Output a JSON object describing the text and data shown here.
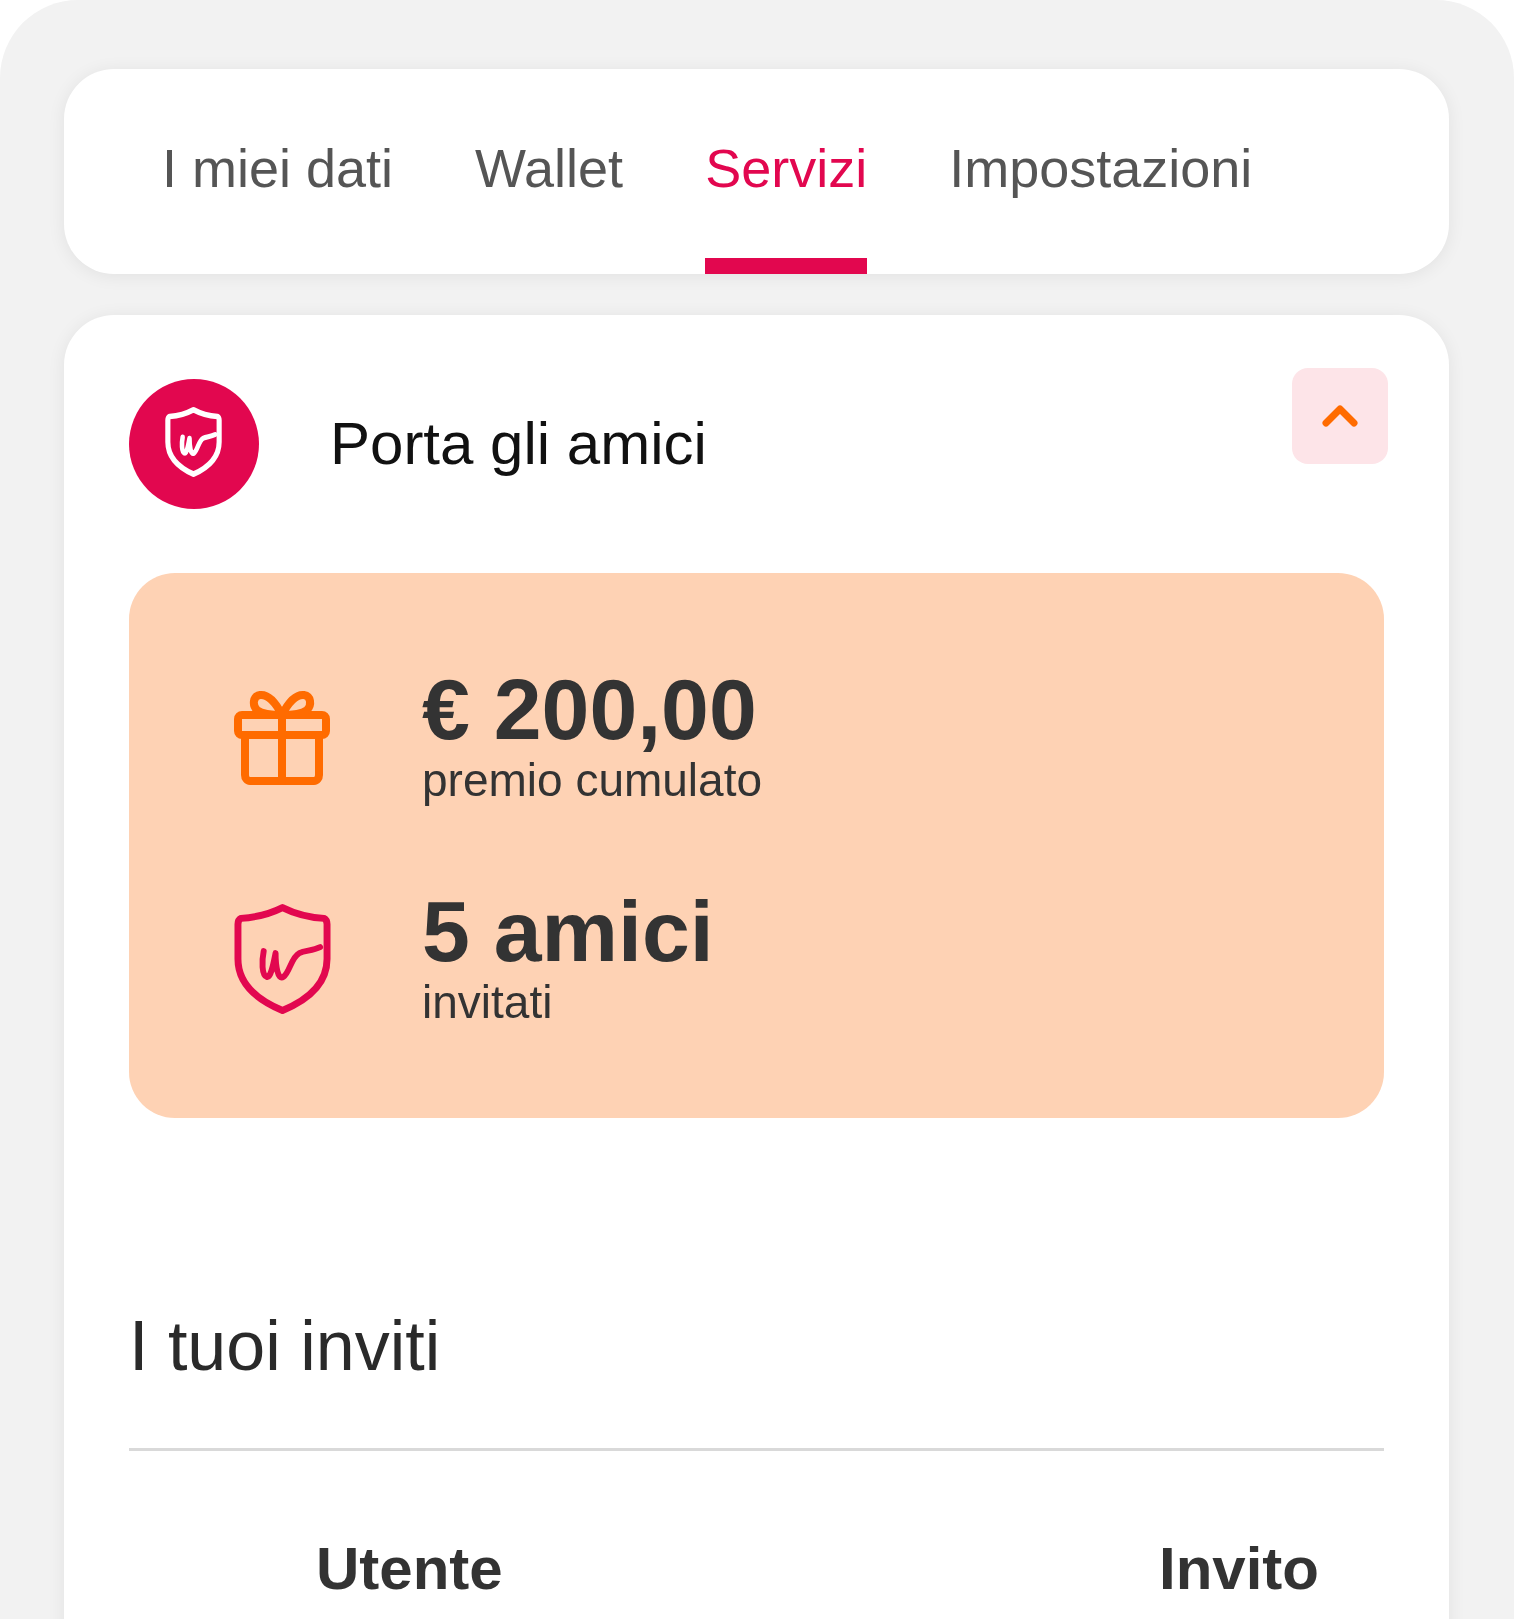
{
  "tabs": [
    {
      "label": "I miei dati",
      "selected": false
    },
    {
      "label": "Wallet",
      "selected": false
    },
    {
      "label": "Servizi",
      "selected": true
    },
    {
      "label": "Impostazioni",
      "selected": false
    }
  ],
  "section": {
    "title": "Porta gli amici",
    "expanded": true,
    "stats": [
      {
        "kind": "gift",
        "value": "€ 200,00",
        "caption": "premio cumulato"
      },
      {
        "kind": "shield",
        "value": "5 amici",
        "caption": "invitati"
      }
    ],
    "invites": {
      "title": "I tuoi inviti",
      "columns": [
        "Utente",
        "Invito"
      ]
    }
  }
}
